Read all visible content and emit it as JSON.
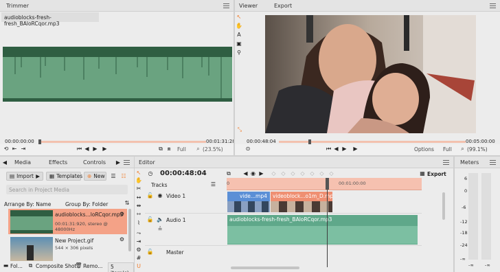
{
  "colors": {
    "accent": "#f07c2a",
    "clip_audio": "#5fa88a",
    "wave_dark": "#2f5e42",
    "wave_light": "#6aa380",
    "playhead": "#3c3c3c",
    "range": "#f6c1b0",
    "video_clip": "#5b8fd6"
  },
  "trimmer": {
    "tab": "Trimmer",
    "file_tab": "audioblocks-fresh-fresh_BAloRCqor.mp3",
    "time_start": "00:00:00:00",
    "time_end": "00:01:31:28",
    "quality": "Full",
    "zoom": "(23.5%)",
    "progress": 0.0
  },
  "viewer": {
    "tab_viewer": "Viewer",
    "tab_export": "Export",
    "timecode": "00:00:48:04",
    "time_end": "00:05:00:00",
    "options": "Options",
    "quality": "Full",
    "zoom": "(99.1%)",
    "progress": 0.16
  },
  "media": {
    "tabs": [
      "Media",
      "Effects",
      "Controls"
    ],
    "import_label": "Import",
    "templates_label": "Templates",
    "new_label": "New",
    "search_placeholder": "Search in Project Media",
    "arrange": "Arrange By: Name",
    "group": "Group By: Folder",
    "items": [
      {
        "name": "audioblocks...loRCqor.mp3",
        "meta": "00:01:31:920, stereo @ 48000Hz"
      },
      {
        "name": "New Project.gif",
        "meta": "544 × 306 pixels"
      }
    ],
    "footer": {
      "folder": "Fol...",
      "composite": "Composite Shot",
      "remove": "Remo...",
      "count": "5 item(s)"
    }
  },
  "editor": {
    "tab": "Editor",
    "timecode": "00:00:48:04",
    "export_label": "Export",
    "tracks_label": "Tracks",
    "ruler_labels": [
      "0",
      "00:01:00:00"
    ],
    "tracks": [
      {
        "name": "Video 1"
      },
      {
        "name": "Audio 1"
      },
      {
        "name": "Master"
      }
    ],
    "clips": {
      "video_a": "vide...mp4",
      "video_b": "videoblock...o1m_D.mp4",
      "audio": "audioblocks-fresh-fresh_BAloRCqor.mp3"
    }
  },
  "meters": {
    "tab": "Meters",
    "scale": [
      "6",
      "0",
      "-6",
      "-12",
      "-18",
      "-24",
      "-∞"
    ],
    "bottom": [
      "L",
      "R"
    ],
    "inf_label": "-∞"
  }
}
